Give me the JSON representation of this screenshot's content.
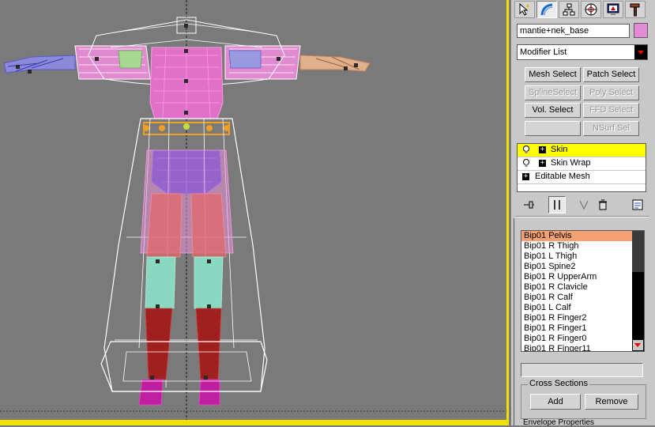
{
  "command_panel": {
    "tabs": [
      {
        "name": "create-tab",
        "icon": "cursor-arrow-icon"
      },
      {
        "name": "modify-tab",
        "icon": "bend-arc-icon"
      },
      {
        "name": "hierarchy-tab",
        "icon": "hierarchy-icon"
      },
      {
        "name": "motion-tab",
        "icon": "motion-wheel-icon"
      },
      {
        "name": "display-tab",
        "icon": "display-monitor-icon"
      },
      {
        "name": "utilities-tab",
        "icon": "hammer-icon"
      }
    ],
    "object_name": "mantie+nek_base",
    "object_color": "#e48ad6",
    "modifier_list_label": "Modifier List",
    "buttons": {
      "mesh_select": "Mesh Select",
      "patch_select": "Patch Select",
      "spline_select": "SplineSelect",
      "poly_select": "Poly Select",
      "vol_select": "Vol. Select",
      "ffd_select": "FFD Select",
      "blank": "",
      "nsurf_sel": "NSurf Sel"
    },
    "stack": [
      {
        "label": "Skin"
      },
      {
        "label": "Skin Wrap"
      },
      {
        "label": "Editable Mesh"
      }
    ],
    "bones": [
      "Bip01 Pelvis",
      "Bip01 R Thigh",
      "Bip01 L Thigh",
      "Bip01 Spine2",
      "Bip01 R UpperArm",
      "Bip01 R Clavicle",
      "Bip01 R Calf",
      "Bip01 L Calf",
      "Bip01 R Finger2",
      "Bip01 R Finger1",
      "Bip01 R Finger0",
      "Bip01 R Finger11"
    ],
    "cross_sections": {
      "title": "Cross Sections",
      "add": "Add",
      "remove": "Remove"
    },
    "next_rollout_title": "Envelope Properties"
  },
  "colors": {
    "viewport_bg": "#7a7a7a",
    "active_viewport_border": "#f0e000",
    "selected_stack": "#ffff00",
    "selected_bone": "#f4a070"
  }
}
